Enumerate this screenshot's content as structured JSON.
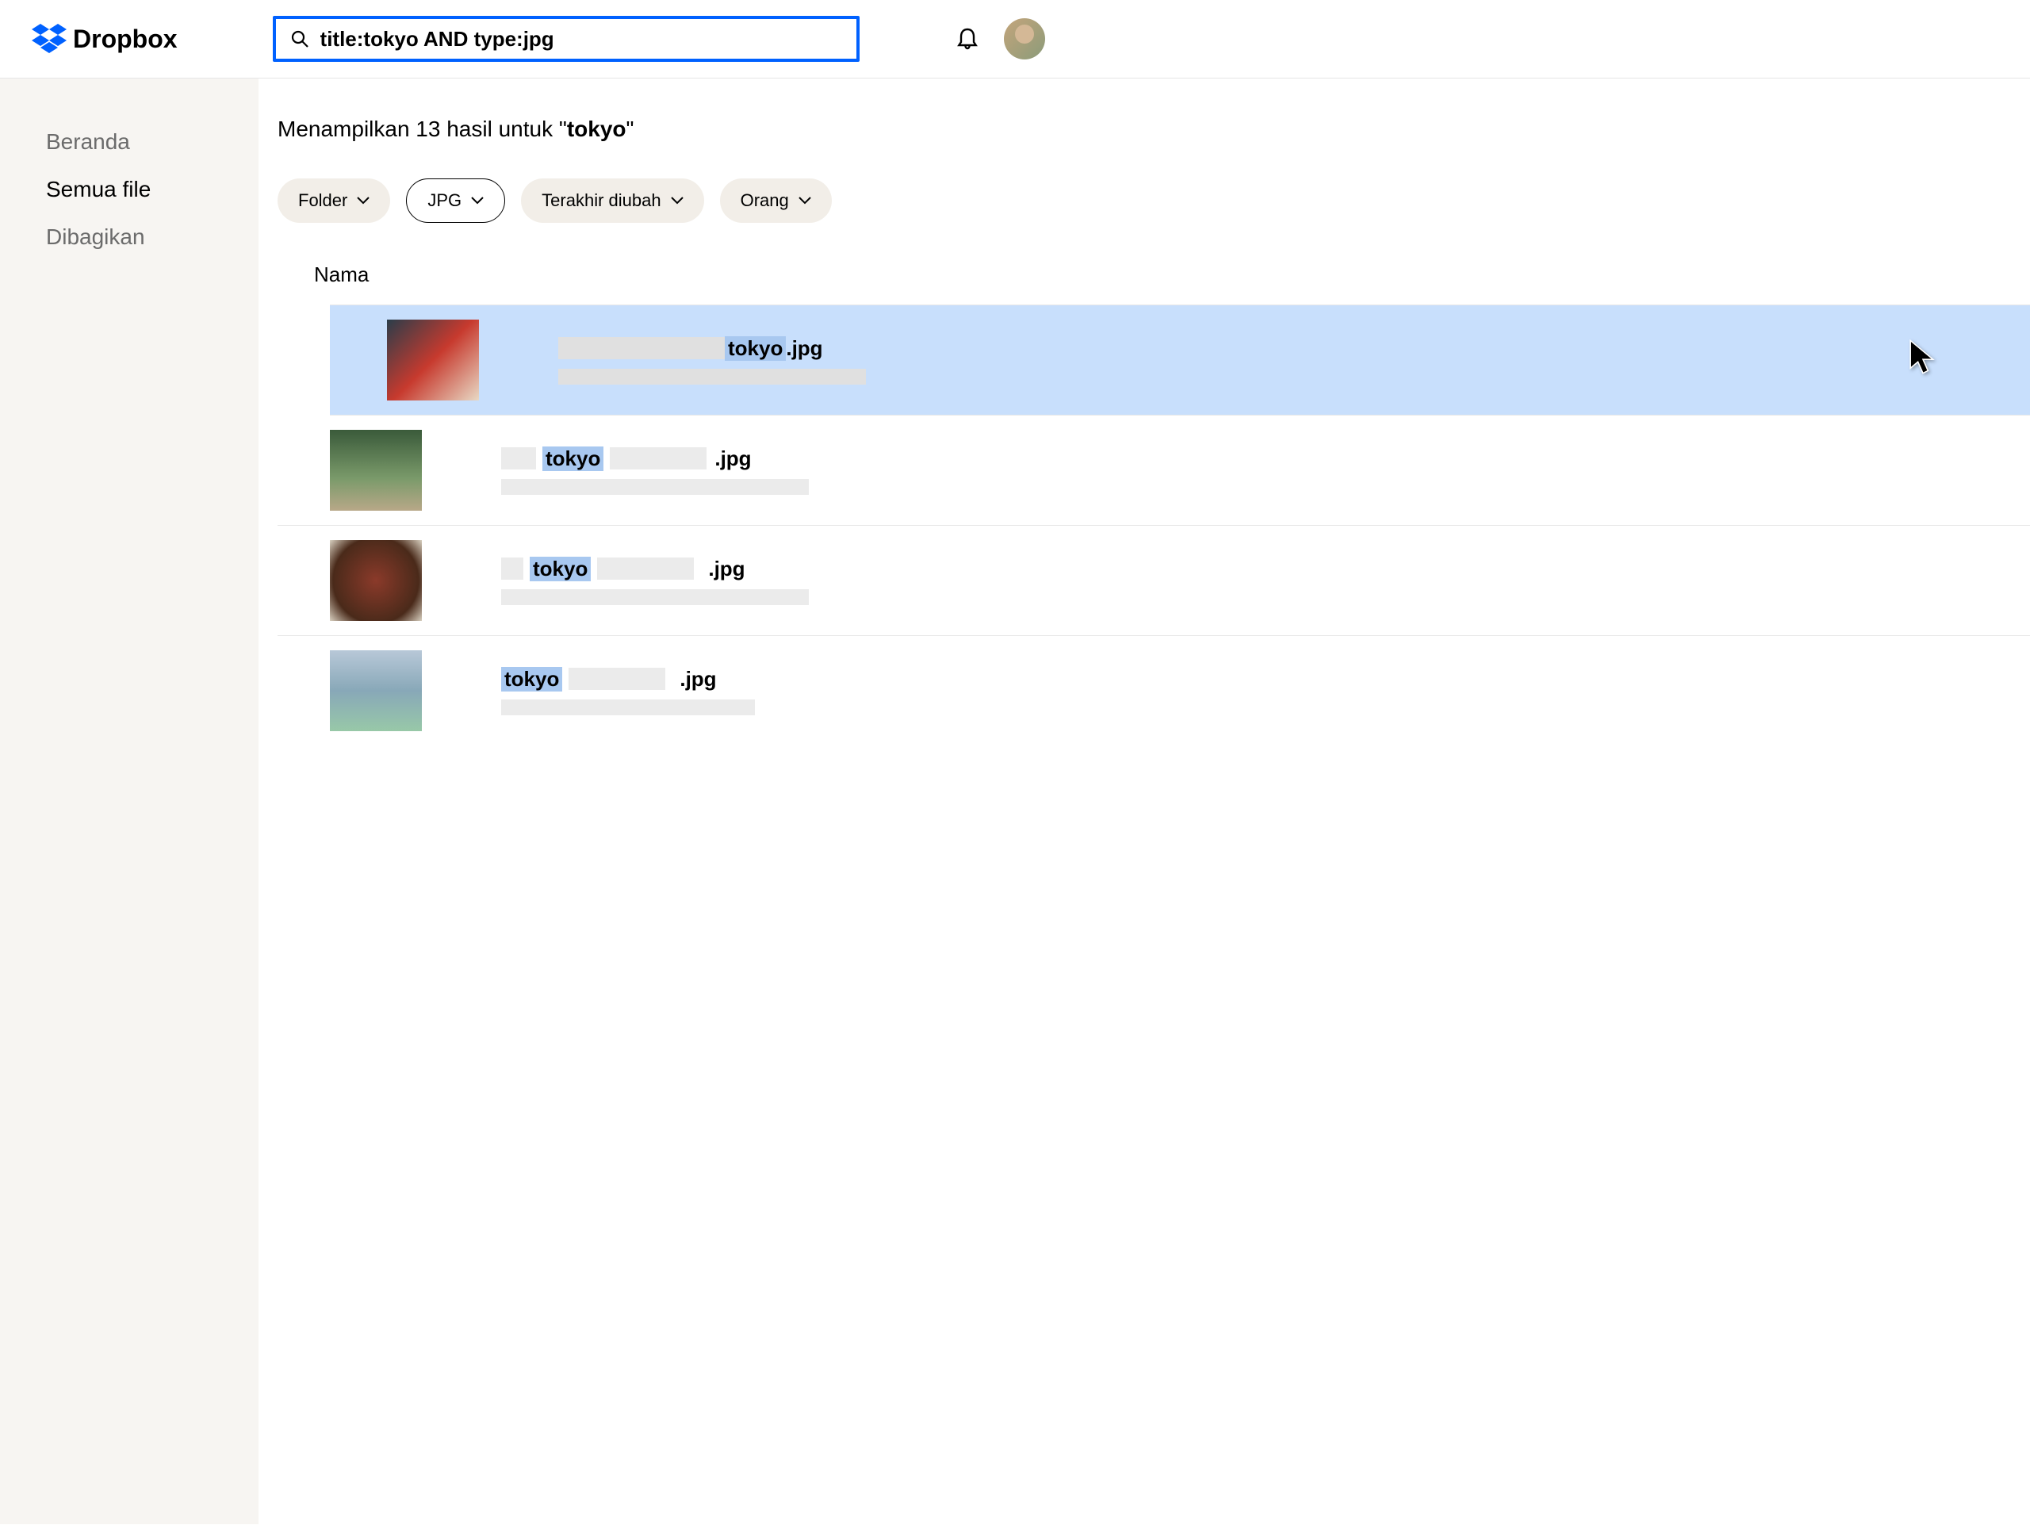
{
  "brand": "Dropbox",
  "search": {
    "query": "title:tokyo AND type:jpg"
  },
  "sidebar": {
    "items": [
      {
        "label": "Beranda",
        "active": false
      },
      {
        "label": "Semua file",
        "active": true
      },
      {
        "label": "Dibagikan",
        "active": false
      }
    ]
  },
  "results": {
    "heading_prefix": "Menampilkan 13 hasil untuk \"",
    "heading_term": "tokyo",
    "heading_suffix": "\"",
    "count": 13,
    "term": "tokyo"
  },
  "filters": [
    {
      "label": "Folder",
      "outlined": false
    },
    {
      "label": "JPG",
      "outlined": true
    },
    {
      "label": "Terakhir diubah",
      "outlined": false
    },
    {
      "label": "Orang",
      "outlined": false
    }
  ],
  "column_header": "Nama",
  "rows": [
    {
      "highlight": "tokyo",
      "ext": ".jpg",
      "selected": true,
      "layout": "right"
    },
    {
      "highlight": "tokyo",
      "ext": ".jpg",
      "selected": false,
      "layout": "mid"
    },
    {
      "highlight": "tokyo",
      "ext": ".jpg",
      "selected": false,
      "layout": "mid2"
    },
    {
      "highlight": "tokyo",
      "ext": ".jpg",
      "selected": false,
      "layout": "left"
    }
  ]
}
